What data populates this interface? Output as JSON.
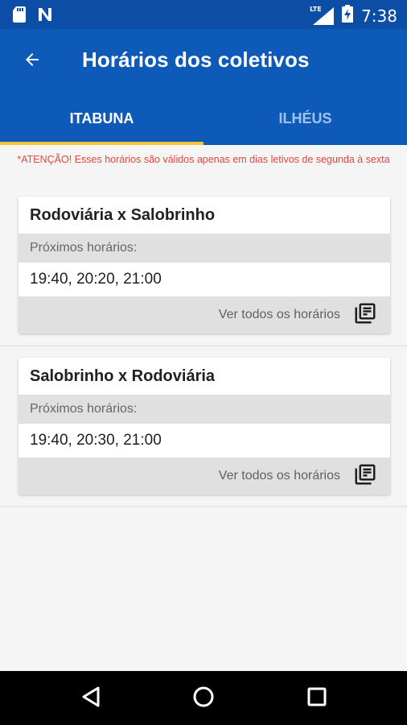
{
  "status_bar": {
    "time": "7:38",
    "network": "LTE",
    "icons": [
      "sd-card-icon",
      "notification-n-icon",
      "signal-icon",
      "battery-charging-icon"
    ]
  },
  "app_bar": {
    "title": "Horários dos coletivos",
    "back_icon": "arrow-back-icon"
  },
  "tabs": [
    {
      "label": "ITABUNA",
      "active": true
    },
    {
      "label": "ILHÉUS",
      "active": false
    }
  ],
  "notice": "*ATENÇÃO! Esses horários são válidos apenas em dias letivos de segunda à sexta",
  "routes": [
    {
      "title": "Rodoviária x Salobrinho",
      "subtitle": "Próximos horários:",
      "times": "19:40, 20:20, 21:00",
      "view_all": "Ver todos os horários",
      "view_all_icon": "library-books-icon"
    },
    {
      "title": "Salobrinho x Rodoviária",
      "subtitle": "Próximos horários:",
      "times": "19:40, 20:30, 21:00",
      "view_all": "Ver todos os horários",
      "view_all_icon": "library-books-icon"
    }
  ],
  "nav_bar": {
    "icons": [
      "back-triangle-icon",
      "home-circle-icon",
      "recents-square-icon"
    ]
  },
  "colors": {
    "primary": "#0d5ab8",
    "status_bar": "#0c4ea6",
    "tab_indicator": "#f7c43a",
    "notice": "#e8453c"
  }
}
